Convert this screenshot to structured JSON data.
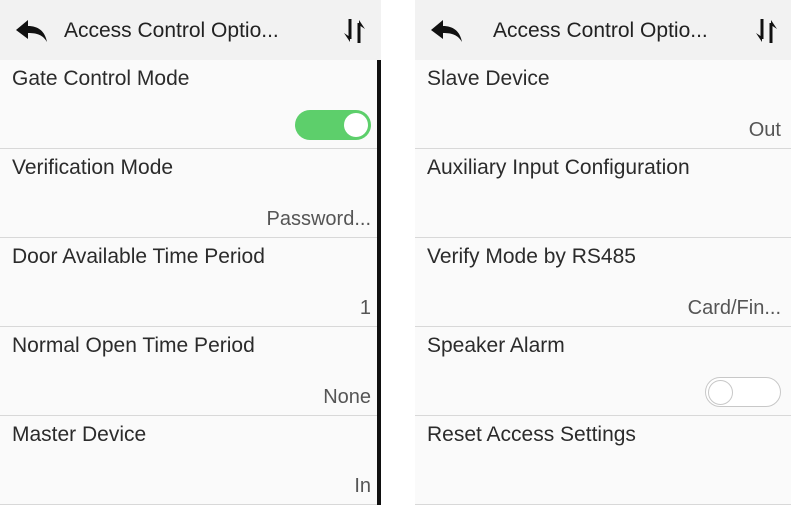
{
  "left_screen": {
    "title": "Access Control Optio...",
    "rows": [
      {
        "label": "Gate Control Mode",
        "toggle": "on"
      },
      {
        "label": "Verification Mode",
        "value": "Password..."
      },
      {
        "label": "Door Available Time Period",
        "value": "1"
      },
      {
        "label": "Normal Open Time Period",
        "value": "None"
      },
      {
        "label": "Master Device",
        "value": "In"
      }
    ]
  },
  "right_screen": {
    "title": "Access Control Optio...",
    "rows": [
      {
        "label": "Slave Device",
        "value": "Out"
      },
      {
        "label": "Auxiliary Input Configuration"
      },
      {
        "label": "Verify Mode by RS485",
        "value": "Card/Fin..."
      },
      {
        "label": "Speaker Alarm",
        "toggle": "off"
      },
      {
        "label": "Reset Access Settings"
      }
    ]
  },
  "icons": {
    "back": "back-arrow-icon",
    "sort": "sort-arrows-icon"
  },
  "colors": {
    "toggle_on": "#5dcf6b",
    "toggle_off_border": "#c8c8c8",
    "header_bg": "#f2f2f2"
  }
}
